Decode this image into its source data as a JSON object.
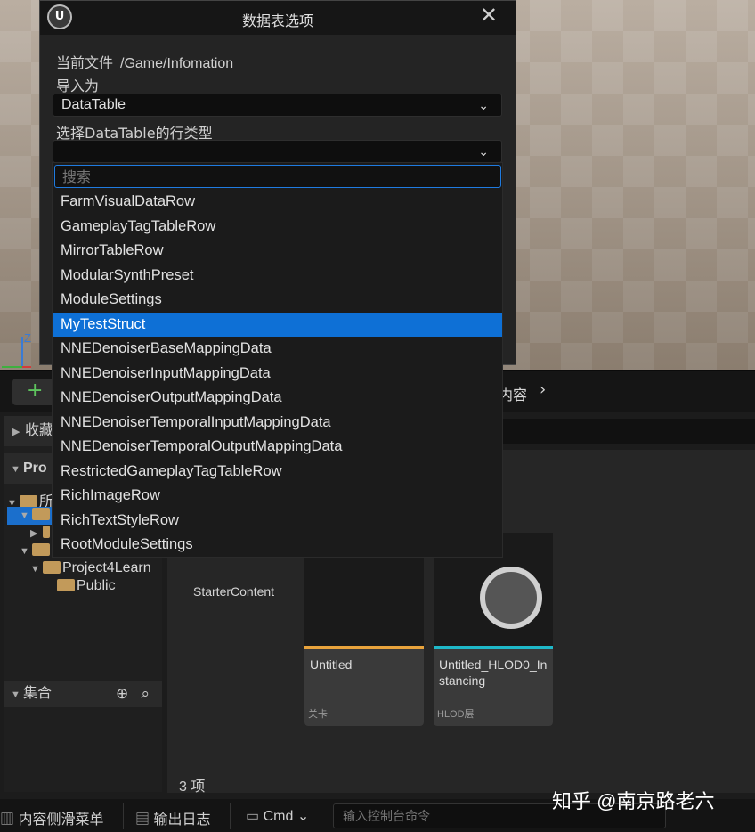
{
  "dialog": {
    "title": "数据表选项",
    "logo": "U",
    "close": "✕",
    "current_file_label": "当前文件",
    "current_file_path": "/Game/Infomation",
    "import_as_label": "导入为",
    "import_as_value": "DataTable",
    "row_type_label": "选择DataTable的行类型",
    "row_type_value": "",
    "chevron": "⌄"
  },
  "dropdown": {
    "search_placeholder": "搜索",
    "items": [
      "FarmVisualDataRow",
      "GameplayTagTableRow",
      "MirrorTableRow",
      "ModularSynthPreset",
      "ModuleSettings",
      "MyTestStruct",
      "NNEDenoiserBaseMappingData",
      "NNEDenoiserInputMappingData",
      "NNEDenoiserOutputMappingData",
      "NNEDenoiserTemporalInputMappingData",
      "NNEDenoiserTemporalOutputMappingData",
      "RestrictedGameplayTagTableRow",
      "RichImageRow",
      "RichTextStyleRow",
      "RootModuleSettings"
    ],
    "selected_index": 5
  },
  "viewport": {
    "axis_label": "Z"
  },
  "content_browser": {
    "add_icon": "+",
    "breadcrumb_label": "内容",
    "breadcrumb_chevron": "›",
    "favorites_label": "收藏",
    "project_label": "Pro",
    "tree": {
      "root_label": "所",
      "project_folder": "Project4Learn",
      "public_folder": "Public"
    },
    "collections_label": "集合",
    "collections_add_icon": "⊕",
    "collections_search_icon": "⌕",
    "assets": [
      {
        "name": "StarterContent"
      },
      {
        "name": "Untitled",
        "type": "关卡",
        "color": "#e8a33c"
      },
      {
        "name": "Untitled_HLOD0_Instancing",
        "type": "HLOD层",
        "color": "#1fb8c8"
      }
    ],
    "item_count": "3 项"
  },
  "status_bar": {
    "content_drawer": "内容侧滑菜单",
    "output_log": "输出日志",
    "cmd": "Cmd",
    "cmd_chevron": "⌄",
    "console_placeholder": "输入控制台命令"
  },
  "watermark": "知乎 @南京路老六"
}
